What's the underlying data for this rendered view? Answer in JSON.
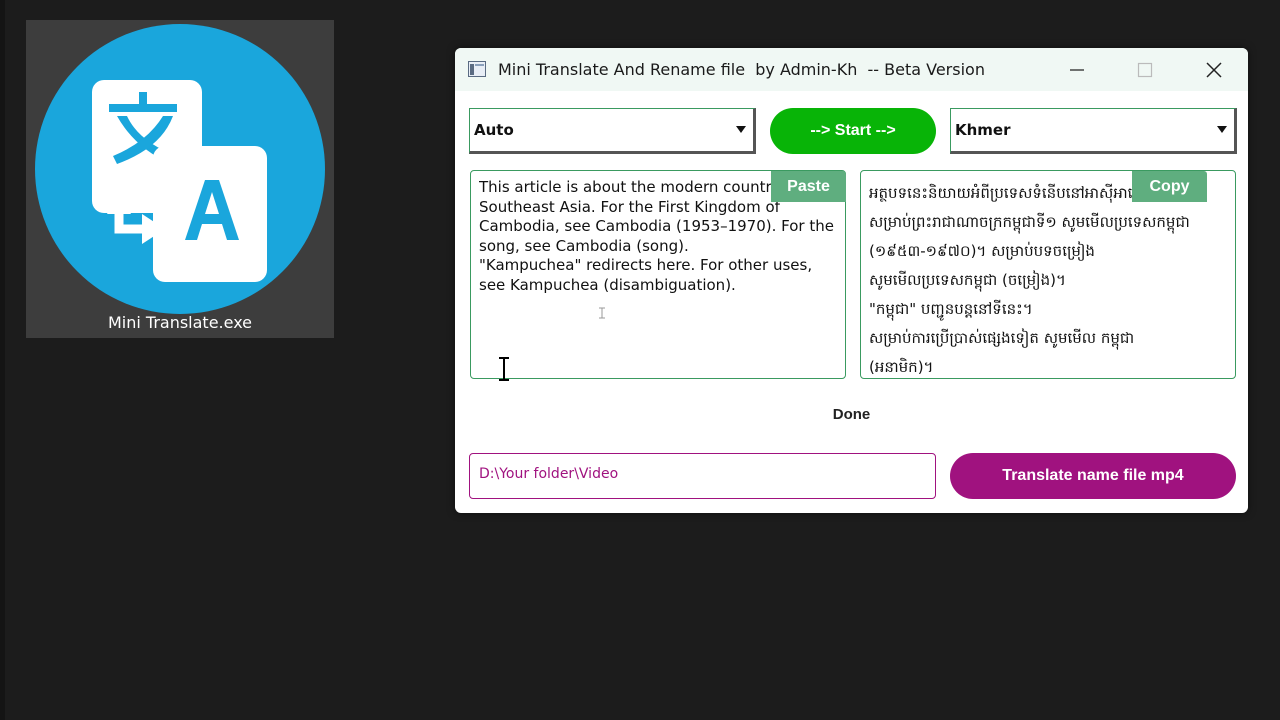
{
  "desktop": {
    "icon_label": "Mini Translate.exe",
    "icon_name": "translate-icon",
    "icon_bg": "#1aa6dc"
  },
  "window": {
    "title": "Mini Translate And Rename file  by Admin-Kh  -- Beta Version",
    "source_language": "Auto",
    "target_language": "Khmer",
    "start_label": "--> Start -->",
    "start_color": "#08b407",
    "paste_label": "Paste",
    "copy_label": "Copy",
    "source_text": "This article is about the modern country in\nSoutheast Asia. For the First Kingdom of\nCambodia, see Cambodia (1953–1970). For the\nsong, see Cambodia (song).\n\"Kampuchea\" redirects here. For other uses,\nsee Kampuchea (disambiguation).",
    "translated_text": "អត្ថបទនេះនិយាយអំពីប្រទេសទំនើបនៅអាស៊ីអាគ្នេយ៍\nសម្រាប់ព្រះរាជាណាចក្រកម្ពុជាទី១ សូមមើលប្រទេសកម្ពុជា\n(១៩៥៣-១៩៧០)។ សម្រាប់បទចម្រៀង\nសូមមើលប្រទេសកម្ពុជា (ចម្រៀង)។\n\"កម្ពុជា\" បញ្ជូនបន្តនៅទីនេះ។\nសម្រាប់ការប្រើប្រាស់ផ្សេងទៀត សូមមើល កម្ពុជា\n(អនាមិក)។",
    "status": "Done",
    "folder_path": "D:\\Your folder\\Video",
    "translate_file_label": "Translate name file mp4",
    "accent_color": "#a0127f"
  }
}
